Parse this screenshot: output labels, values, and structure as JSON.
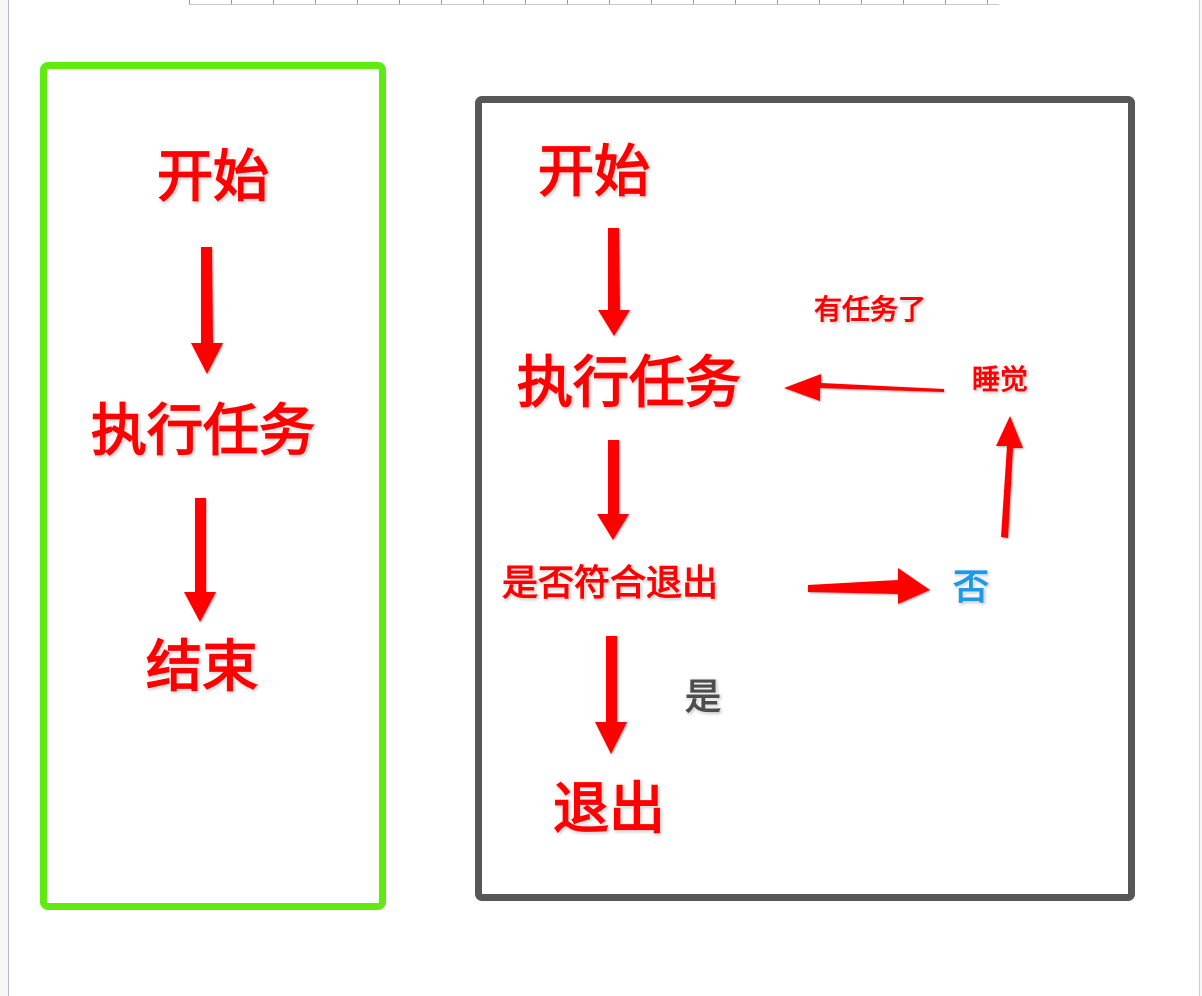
{
  "diagrams": {
    "simple_flow": {
      "start": "开始",
      "execute_task": "执行任务",
      "end": "结束"
    },
    "loop_flow": {
      "start": "开始",
      "execute_task": "执行任务",
      "exit_check": "是否符合退出",
      "no": "否",
      "yes": "是",
      "exit": "退出",
      "sleep": "睡觉",
      "has_task": "有任务了"
    }
  },
  "colors": {
    "simple_panel_border": "#5fea10",
    "loop_panel_border": "#575757",
    "arrow": "#ff0000",
    "text": "#ff0000",
    "yes_text": "#4d4d4d",
    "no_text": "#1e98e8"
  }
}
